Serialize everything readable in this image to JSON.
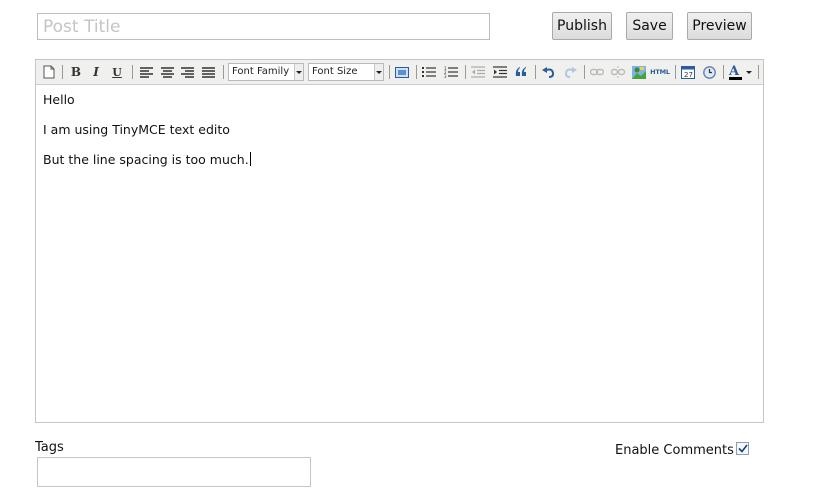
{
  "post": {
    "title_placeholder": "Post Title",
    "title_value": ""
  },
  "actions": {
    "publish": "Publish",
    "save": "Save",
    "preview": "Preview"
  },
  "toolbar": {
    "bold": "B",
    "italic": "I",
    "underline": "U",
    "font_family": "Font Family",
    "font_size": "Font Size",
    "html": "HTML",
    "icons": [
      "new-document-icon",
      "bold-icon",
      "italic-icon",
      "underline-icon",
      "align-left-icon",
      "align-center-icon",
      "align-right-icon",
      "align-justify-icon",
      "font-family-select",
      "font-size-select",
      "style-icon",
      "bullet-list-icon",
      "numbered-list-icon",
      "outdent-icon",
      "indent-icon",
      "blockquote-icon",
      "undo-icon",
      "redo-icon",
      "link-icon",
      "unlink-icon",
      "image-icon",
      "html-icon",
      "insert-date-icon",
      "insert-time-icon",
      "text-color-icon"
    ]
  },
  "editor": {
    "lines": [
      "Hello",
      "I am using TinyMCE text edito",
      "But the line spacing is too much."
    ]
  },
  "tags": {
    "label": "Tags",
    "value": ""
  },
  "comments": {
    "label": "Enable Comments",
    "checked": true
  },
  "colors": {
    "toolbar_bg": "#f0f0ee",
    "border": "#c5c5c5",
    "icon_blue": "#2b5d9b",
    "text_color_bar": "#000000"
  }
}
